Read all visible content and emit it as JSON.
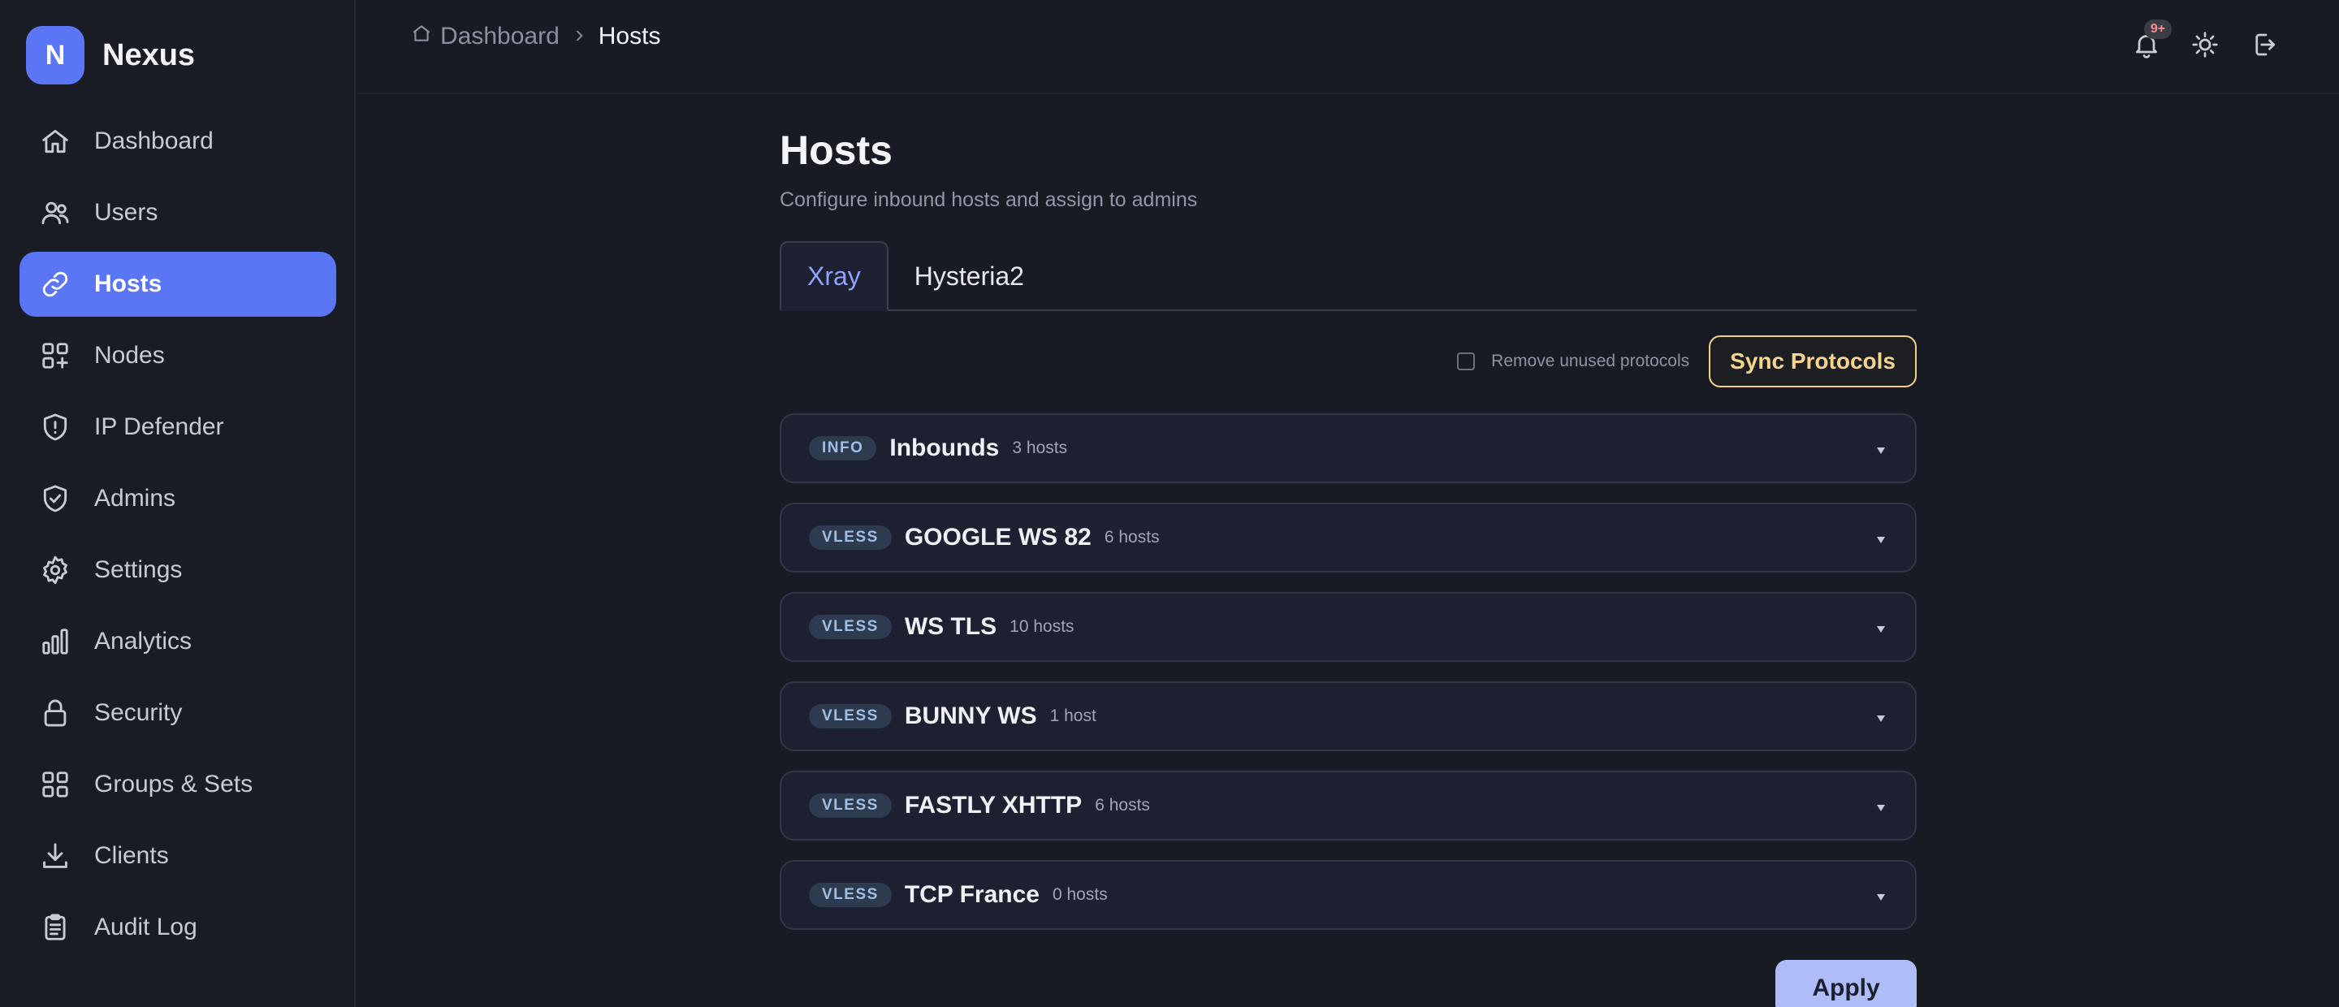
{
  "brand": {
    "logo_letter": "N",
    "name": "Nexus",
    "accent": "#5b76f4"
  },
  "sidebar": {
    "items": [
      {
        "label": "Dashboard",
        "icon": "home-icon",
        "active": false
      },
      {
        "label": "Users",
        "icon": "users-icon",
        "active": false
      },
      {
        "label": "Hosts",
        "icon": "link-icon",
        "active": true
      },
      {
        "label": "Nodes",
        "icon": "nodes-icon",
        "active": false
      },
      {
        "label": "IP Defender",
        "icon": "shield-alert-icon",
        "active": false
      },
      {
        "label": "Admins",
        "icon": "shield-check-icon",
        "active": false
      },
      {
        "label": "Settings",
        "icon": "gear-icon",
        "active": false
      },
      {
        "label": "Analytics",
        "icon": "bar-chart-icon",
        "active": false
      },
      {
        "label": "Security",
        "icon": "lock-icon",
        "active": false
      },
      {
        "label": "Groups & Sets",
        "icon": "grid-icon",
        "active": false
      },
      {
        "label": "Clients",
        "icon": "download-icon",
        "active": false
      },
      {
        "label": "Audit Log",
        "icon": "clipboard-icon",
        "active": false
      }
    ]
  },
  "header": {
    "breadcrumb": {
      "parent": "Dashboard",
      "current": "Hosts"
    },
    "notification_badge": "9+"
  },
  "main": {
    "title": "Hosts",
    "subtitle": "Configure inbound hosts and assign to admins",
    "tabs": [
      {
        "label": "Xray",
        "active": true
      },
      {
        "label": "Hysteria2",
        "active": false
      }
    ],
    "remove_unused_label": "Remove unused protocols",
    "sync_label": "Sync Protocols",
    "groups": [
      {
        "tag": "INFO",
        "name": "Inbounds",
        "count": "3 hosts"
      },
      {
        "tag": "VLESS",
        "name": "GOOGLE WS 82",
        "count": "6 hosts"
      },
      {
        "tag": "VLESS",
        "name": "WS TLS",
        "count": "10 hosts"
      },
      {
        "tag": "VLESS",
        "name": "BUNNY WS",
        "count": "1 host"
      },
      {
        "tag": "VLESS",
        "name": "FASTLY XHTTP",
        "count": "6 hosts"
      },
      {
        "tag": "VLESS",
        "name": "TCP France",
        "count": "0 hosts"
      }
    ],
    "apply_label": "Apply"
  },
  "colors": {
    "background": "#191b24",
    "accent": "#5b76f4",
    "sync_border": "#f5d08a",
    "apply_bg": "#aebcf8",
    "tab_active": "#8fa3ff"
  }
}
